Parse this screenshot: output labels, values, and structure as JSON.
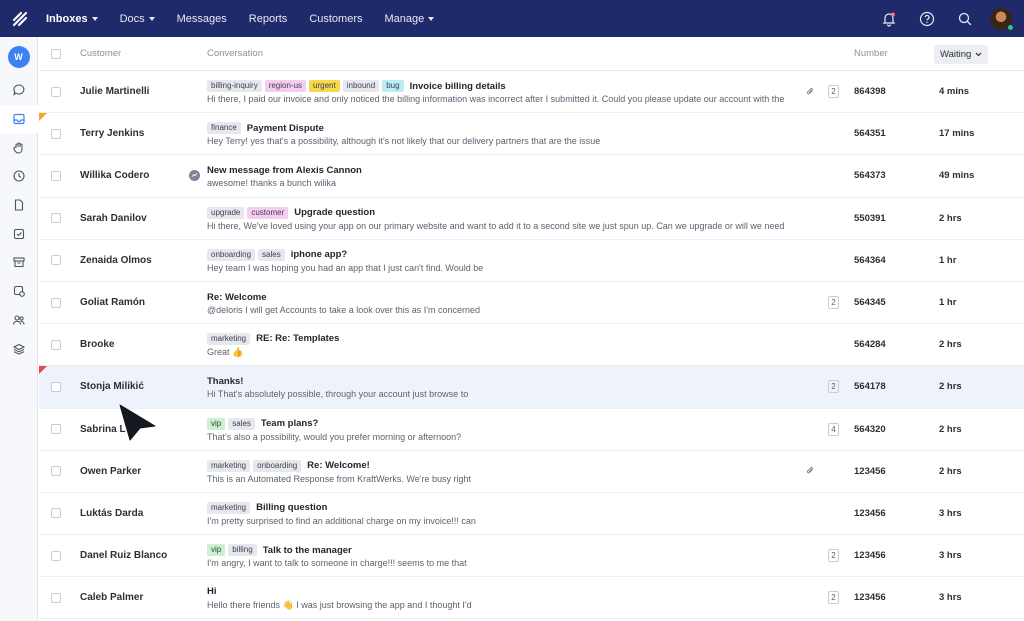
{
  "topnav": {
    "items": [
      {
        "label": "Inboxes",
        "dropdown": true
      },
      {
        "label": "Docs",
        "dropdown": true
      },
      {
        "label": "Messages",
        "dropdown": false
      },
      {
        "label": "Reports",
        "dropdown": false
      },
      {
        "label": "Customers",
        "dropdown": false
      },
      {
        "label": "Manage",
        "dropdown": true
      }
    ],
    "icons": [
      "notifications-bell-icon",
      "help-icon",
      "search-icon",
      "user-avatar"
    ]
  },
  "sidebar": {
    "workspace_initial": "W",
    "icons": [
      "chat-icon",
      "inbox-icon",
      "hand-icon",
      "clock-icon",
      "document-icon",
      "check-doc-icon",
      "archive-icon",
      "search-check-icon",
      "users-icon",
      "layers-icon"
    ]
  },
  "table": {
    "headers": {
      "customer": "Customer",
      "conversation": "Conversation",
      "number": "Number",
      "waiting": "Waiting"
    },
    "rows": [
      {
        "customer": "Julie Martinelli",
        "tags": [
          {
            "t": "billing-inquiry",
            "c": "#e6e8ee"
          },
          {
            "t": "region-us",
            "c": "#f6cdf0"
          },
          {
            "t": "urgent",
            "c": "#f7d84a"
          },
          {
            "t": "inbound",
            "c": "#e6e8ee"
          },
          {
            "t": "bug",
            "c": "#b9ecf3"
          }
        ],
        "subject": "Invoice billing details",
        "preview": "Hi there, I paid our invoice and only noticed the billing information was  incorrect after I submitted it. Could you please update our account with the",
        "clip": true,
        "count": "2",
        "number": "864398",
        "waiting": "4 mins",
        "flag": "",
        "messenger": false
      },
      {
        "customer": "Terry Jenkins",
        "tags": [
          {
            "t": "finance",
            "c": "#e6e8ee"
          }
        ],
        "subject": "Payment Dispute",
        "preview": "Hey Terry! yes that's a possibility, although it's not likely that our delivery partners that are the issue",
        "clip": false,
        "count": "",
        "number": "564351",
        "waiting": "17 mins",
        "flag": "orange",
        "messenger": false
      },
      {
        "customer": "Willika Codero",
        "tags": [],
        "subject": "New message from Alexis Cannon",
        "preview": "awesome! thanks a bunch wilika",
        "clip": false,
        "count": "",
        "number": "564373",
        "waiting": "49 mins",
        "flag": "",
        "messenger": true
      },
      {
        "customer": "Sarah Danilov",
        "tags": [
          {
            "t": "upgrade",
            "c": "#e6e8ee"
          },
          {
            "t": "customer",
            "c": "#f6cdf0"
          }
        ],
        "subject": "Upgrade question",
        "preview": "Hi there, We've loved using your app on our primary website and want to add it to a second site we just spun up. Can we upgrade or will we need",
        "clip": false,
        "count": "",
        "number": "550391",
        "waiting": "2 hrs",
        "flag": "",
        "messenger": false
      },
      {
        "customer": "Zenaida Olmos",
        "tags": [
          {
            "t": "onboarding",
            "c": "#e6e8ee"
          },
          {
            "t": "sales",
            "c": "#e6e8ee"
          }
        ],
        "subject": "iphone app?",
        "preview": "Hey team I was hoping you had an app that I just can't find. Would be",
        "clip": false,
        "count": "",
        "number": "564364",
        "waiting": "1 hr",
        "flag": "",
        "messenger": false
      },
      {
        "customer": "Goliat Ramón",
        "tags": [],
        "subject": "Re: Welcome",
        "preview": "@deloris I will get Accounts to take a look over this as I'm concerned",
        "clip": false,
        "count": "2",
        "number": "564345",
        "waiting": "1 hr",
        "flag": "",
        "messenger": false
      },
      {
        "customer": "Brooke",
        "tags": [
          {
            "t": "marketing",
            "c": "#e6e8ee"
          }
        ],
        "subject": "RE: Re: Templates",
        "preview": "Great 👍",
        "clip": false,
        "count": "",
        "number": "564284",
        "waiting": "2 hrs",
        "flag": "",
        "messenger": false
      },
      {
        "customer": "Stonja Milikić",
        "tags": [],
        "subject": "Thanks!",
        "preview": "Hi That's absolutely possible, through your account just browse to",
        "clip": false,
        "count": "2",
        "number": "564178",
        "waiting": "2 hrs",
        "flag": "red",
        "messenger": false,
        "highlight": true
      },
      {
        "customer": "Sabrina L",
        "tags": [
          {
            "t": "vip",
            "c": "#c9f0cf"
          },
          {
            "t": "sales",
            "c": "#e6e8ee"
          }
        ],
        "subject": "Team plans?",
        "preview": "That's also a possibility, would you prefer morning or afternoon?",
        "clip": false,
        "count": "4",
        "number": "564320",
        "waiting": "2 hrs",
        "flag": "",
        "messenger": false
      },
      {
        "customer": "Owen Parker",
        "tags": [
          {
            "t": "marketing",
            "c": "#e6e8ee"
          },
          {
            "t": "onboarding",
            "c": "#e6e8ee"
          }
        ],
        "subject": "Re: Welcome!",
        "preview": "This is an Automated Response from KraftWerks. We're busy right",
        "clip": true,
        "count": "",
        "number": "123456",
        "waiting": "2 hrs",
        "flag": "",
        "messenger": false
      },
      {
        "customer": "Luktás Darda",
        "tags": [
          {
            "t": "marketing",
            "c": "#e6e8ee"
          }
        ],
        "subject": "Billing question",
        "preview": "I'm pretty surprised to find an additional charge on my invoice!!! can",
        "clip": false,
        "count": "",
        "number": "123456",
        "waiting": "3 hrs",
        "flag": "",
        "messenger": false
      },
      {
        "customer": "Danel Ruiz Blanco",
        "tags": [
          {
            "t": "vip",
            "c": "#c9f0cf"
          },
          {
            "t": "billing",
            "c": "#e6e8ee"
          }
        ],
        "subject": "Talk to the manager",
        "preview": "I'm angry, I want to talk to someone in charge!!! seems to me that",
        "clip": false,
        "count": "2",
        "number": "123456",
        "waiting": "3 hrs",
        "flag": "",
        "messenger": false
      },
      {
        "customer": "Caleb Palmer",
        "tags": [],
        "subject": "Hi",
        "preview": "Hello there friends 👋 I was just browsing the app and I thought I'd",
        "clip": false,
        "count": "2",
        "number": "123456",
        "waiting": "3 hrs",
        "flag": "",
        "messenger": false
      }
    ]
  }
}
